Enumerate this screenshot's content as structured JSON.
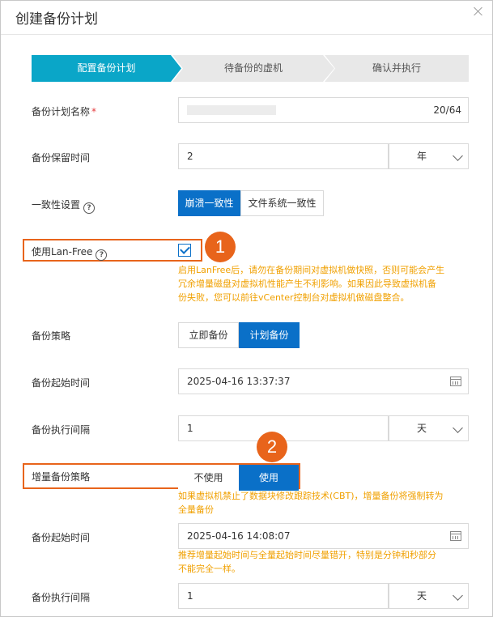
{
  "dialog": {
    "title": "创建备份计划"
  },
  "steps": [
    "配置备份计划",
    "待备份的虚机",
    "确认并执行"
  ],
  "form": {
    "name": {
      "label": "备份计划名称",
      "required_mark": "*",
      "counter": "20/64"
    },
    "retention": {
      "label": "备份保留时间",
      "value": "2",
      "unit": "年"
    },
    "consistency": {
      "label": "一致性设置",
      "help": "?",
      "options": [
        "崩溃一致性",
        "文件系统一致性"
      ],
      "selected": "崩溃一致性"
    },
    "lanfree": {
      "label": "使用Lan-Free",
      "help": "?",
      "checked": true,
      "warning": [
        "启用LanFree后，请勿在备份期间对虚拟机做快照，否则可能会产生",
        "冗余增量磁盘对虚拟机性能产生不利影响。如果因此导致虚拟机备",
        "份失败，您可以前往vCenter控制台对虚拟机做磁盘整合。"
      ]
    },
    "strategy": {
      "label": "备份策略",
      "options": [
        "立即备份",
        "计划备份"
      ],
      "selected": "计划备份"
    },
    "start_time": {
      "label": "备份起始时间",
      "value": "2025-04-16 13:37:37"
    },
    "interval": {
      "label": "备份执行间隔",
      "value": "1",
      "unit": "天"
    },
    "incremental": {
      "label": "增量备份策略",
      "options": [
        "不使用",
        "使用"
      ],
      "selected": "使用",
      "warning": [
        "如果虚拟机禁止了数据块修改跟踪技术(CBT)，增量备份将强制转为",
        "全量备份"
      ]
    },
    "inc_start_time": {
      "label": "备份起始时间",
      "value": "2025-04-16 14:08:07",
      "warning": [
        "推荐增量起始时间与全量起始时间尽量错开，特别是分钟和秒部分",
        "不能完全一样。"
      ]
    },
    "inc_interval": {
      "label": "备份执行间隔",
      "value": "1",
      "unit": "天"
    }
  },
  "annotations": {
    "badge1": "1",
    "badge2": "2",
    "color": "#e8641b"
  },
  "colors": {
    "accent": "#0a70c8",
    "step_active": "#0aa6c8",
    "warning": "#f0a000"
  }
}
